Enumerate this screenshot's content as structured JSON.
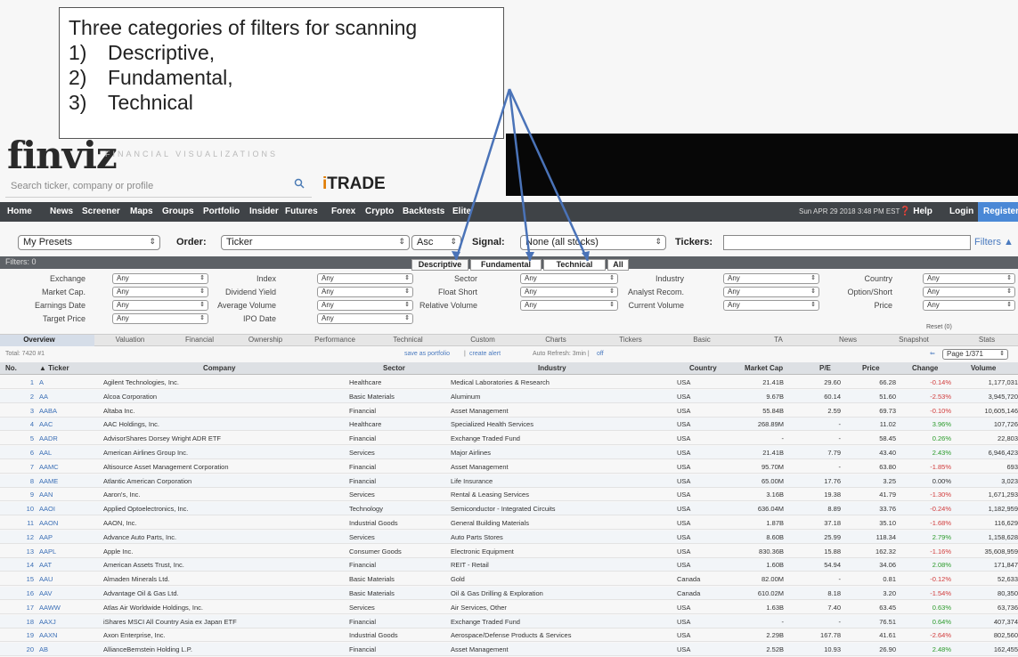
{
  "callout": {
    "title": "Three categories of filters for scanning",
    "items": [
      {
        "num": "1)",
        "label": "Descriptive,"
      },
      {
        "num": "2)",
        "label": "Fundamental,"
      },
      {
        "num": "3)",
        "label": "Technical"
      }
    ]
  },
  "header": {
    "logo": "finviz",
    "tagline": "FINANCIAL VISUALIZATIONS",
    "search_placeholder": "Search ticker, company or profile",
    "itrade_i": "i",
    "itrade_rest": "TRADE"
  },
  "nav": {
    "items": [
      "Home",
      "News",
      "Screener",
      "Maps",
      "Groups",
      "Portfolio",
      "Insider",
      "Futures",
      "Forex",
      "Crypto",
      "Backtests",
      "Elite"
    ],
    "datetime": "Sun APR 29 2018 3:48 PM EST",
    "help": "❓ Help",
    "login": "Login",
    "register": "Register"
  },
  "controls": {
    "presets": "My Presets",
    "order_label": "Order:",
    "order_value": "Ticker",
    "direction": "Asc",
    "signal_label": "Signal:",
    "signal_value": "None (all stocks)",
    "tickers_label": "Tickers:",
    "filters_label": "Filters ▲"
  },
  "filters": {
    "label": "Filters: 0",
    "tabs": [
      "Descriptive",
      "Fundamental",
      "Technical",
      "All"
    ],
    "rows": [
      [
        [
          "Exchange",
          "Any"
        ],
        [
          "Index",
          "Any"
        ],
        [
          "Sector",
          "Any"
        ],
        [
          "Industry",
          "Any"
        ],
        [
          "Country",
          "Any"
        ]
      ],
      [
        [
          "Market Cap.",
          "Any"
        ],
        [
          "Dividend Yield",
          "Any"
        ],
        [
          "Float Short",
          "Any"
        ],
        [
          "Analyst Recom.",
          "Any"
        ],
        [
          "Option/Short",
          "Any"
        ]
      ],
      [
        [
          "Earnings Date",
          "Any"
        ],
        [
          "Average Volume",
          "Any"
        ],
        [
          "Relative Volume",
          "Any"
        ],
        [
          "Current Volume",
          "Any"
        ],
        [
          "Price",
          "Any"
        ]
      ],
      [
        [
          "Target Price",
          "Any"
        ],
        [
          "IPO Date",
          "Any"
        ]
      ]
    ],
    "reset": "Reset (0)"
  },
  "views": [
    "Overview",
    "Valuation",
    "Financial",
    "Ownership",
    "Performance",
    "Technical",
    "Custom",
    "Charts",
    "Tickers",
    "Basic",
    "TA",
    "News",
    "Snapshot",
    "Stats"
  ],
  "meta": {
    "total": "Total: 7420 #1",
    "save": "save as portfolio",
    "sep": "|",
    "alert": "create alert",
    "refresh": "Auto Refresh: 3min |",
    "off": "off",
    "page": "Page 1/371"
  },
  "table": {
    "headers": [
      "No.",
      "▲ Ticker",
      "Company",
      "Sector",
      "Industry",
      "Country",
      "Market Cap",
      "P/E",
      "Price",
      "Change",
      "Volume"
    ],
    "rows": [
      [
        "1",
        "A",
        "Agilent Technologies, Inc.",
        "Healthcare",
        "Medical Laboratories & Research",
        "USA",
        "21.41B",
        "29.60",
        "66.28",
        "-0.14%",
        "1,177,031"
      ],
      [
        "2",
        "AA",
        "Alcoa Corporation",
        "Basic Materials",
        "Aluminum",
        "USA",
        "9.67B",
        "60.14",
        "51.60",
        "-2.53%",
        "3,945,720"
      ],
      [
        "3",
        "AABA",
        "Altaba Inc.",
        "Financial",
        "Asset Management",
        "USA",
        "55.84B",
        "2.59",
        "69.73",
        "-0.10%",
        "10,605,146"
      ],
      [
        "4",
        "AAC",
        "AAC Holdings, Inc.",
        "Healthcare",
        "Specialized Health Services",
        "USA",
        "268.89M",
        "-",
        "11.02",
        "3.96%",
        "107,726"
      ],
      [
        "5",
        "AADR",
        "AdvisorShares Dorsey Wright ADR ETF",
        "Financial",
        "Exchange Traded Fund",
        "USA",
        "-",
        "-",
        "58.45",
        "0.26%",
        "22,803"
      ],
      [
        "6",
        "AAL",
        "American Airlines Group Inc.",
        "Services",
        "Major Airlines",
        "USA",
        "21.41B",
        "7.79",
        "43.40",
        "2.43%",
        "6,946,423"
      ],
      [
        "7",
        "AAMC",
        "Altisource Asset Management Corporation",
        "Financial",
        "Asset Management",
        "USA",
        "95.70M",
        "-",
        "63.80",
        "-1.85%",
        "693"
      ],
      [
        "8",
        "AAME",
        "Atlantic American Corporation",
        "Financial",
        "Life Insurance",
        "USA",
        "65.00M",
        "17.76",
        "3.25",
        "0.00%",
        "3,023"
      ],
      [
        "9",
        "AAN",
        "Aaron's, Inc.",
        "Services",
        "Rental & Leasing Services",
        "USA",
        "3.16B",
        "19.38",
        "41.79",
        "-1.30%",
        "1,671,293"
      ],
      [
        "10",
        "AAOI",
        "Applied Optoelectronics, Inc.",
        "Technology",
        "Semiconductor - Integrated Circuits",
        "USA",
        "636.04M",
        "8.89",
        "33.76",
        "-0.24%",
        "1,182,959"
      ],
      [
        "11",
        "AAON",
        "AAON, Inc.",
        "Industrial Goods",
        "General Building Materials",
        "USA",
        "1.87B",
        "37.18",
        "35.10",
        "-1.68%",
        "116,629"
      ],
      [
        "12",
        "AAP",
        "Advance Auto Parts, Inc.",
        "Services",
        "Auto Parts Stores",
        "USA",
        "8.60B",
        "25.99",
        "118.34",
        "2.79%",
        "1,158,628"
      ],
      [
        "13",
        "AAPL",
        "Apple Inc.",
        "Consumer Goods",
        "Electronic Equipment",
        "USA",
        "830.36B",
        "15.88",
        "162.32",
        "-1.16%",
        "35,608,959"
      ],
      [
        "14",
        "AAT",
        "American Assets Trust, Inc.",
        "Financial",
        "REIT - Retail",
        "USA",
        "1.60B",
        "54.94",
        "34.06",
        "2.08%",
        "171,847"
      ],
      [
        "15",
        "AAU",
        "Almaden Minerals Ltd.",
        "Basic Materials",
        "Gold",
        "Canada",
        "82.00M",
        "-",
        "0.81",
        "-0.12%",
        "52,633"
      ],
      [
        "16",
        "AAV",
        "Advantage Oil & Gas Ltd.",
        "Basic Materials",
        "Oil & Gas Drilling & Exploration",
        "Canada",
        "610.02M",
        "8.18",
        "3.20",
        "-1.54%",
        "80,350"
      ],
      [
        "17",
        "AAWW",
        "Atlas Air Worldwide Holdings, Inc.",
        "Services",
        "Air Services, Other",
        "USA",
        "1.63B",
        "7.40",
        "63.45",
        "0.63%",
        "63,736"
      ],
      [
        "18",
        "AAXJ",
        "iShares MSCI All Country Asia ex Japan ETF",
        "Financial",
        "Exchange Traded Fund",
        "USA",
        "-",
        "-",
        "76.51",
        "0.64%",
        "407,374"
      ],
      [
        "19",
        "AAXN",
        "Axon Enterprise, Inc.",
        "Industrial Goods",
        "Aerospace/Defense Products & Services",
        "USA",
        "2.29B",
        "167.78",
        "41.61",
        "-2.64%",
        "802,560"
      ],
      [
        "20",
        "AB",
        "AllianceBernstein Holding L.P.",
        "Financial",
        "Asset Management",
        "USA",
        "2.52B",
        "10.93",
        "26.90",
        "2.48%",
        "162,455"
      ]
    ]
  }
}
